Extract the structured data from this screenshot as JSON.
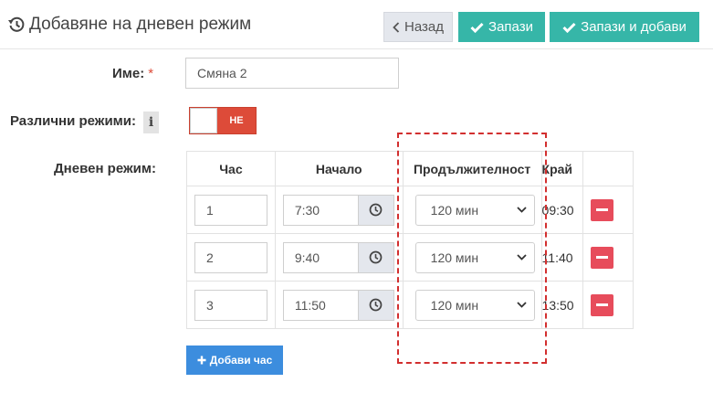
{
  "header": {
    "title": "Добавяне на дневен режим",
    "back_label": "Назад",
    "save_label": "Запази",
    "save_add_label": "Запази и добави"
  },
  "form": {
    "name_label": "Име:",
    "required_mark": "*",
    "name_value": "Смяна 2",
    "modes_label": "Различни режими:",
    "info_glyph": "i",
    "toggle_text": "НЕ",
    "schedule_label": "Дневен режим:"
  },
  "table": {
    "headers": {
      "hour": "Час",
      "start": "Начало",
      "duration": "Продължителност",
      "end": "Край"
    },
    "rows": [
      {
        "hour": "1",
        "start": "7:30",
        "duration": "120 мин",
        "end": "09:30"
      },
      {
        "hour": "2",
        "start": "9:40",
        "duration": "120 мин",
        "end": "11:40"
      },
      {
        "hour": "3",
        "start": "11:50",
        "duration": "120 мин",
        "end": "13:50"
      }
    ]
  },
  "add_hour_label": "Добави час",
  "colors": {
    "teal": "#36b6a8",
    "danger": "#dd4b39",
    "delete": "#e74c5b",
    "primary": "#3c8dde",
    "highlight": "#d22f2f"
  },
  "icons": [
    "history-icon",
    "chevron-left-icon",
    "check-icon",
    "info-icon",
    "clock-icon",
    "chevron-down-icon",
    "minus-icon",
    "plus-icon"
  ]
}
